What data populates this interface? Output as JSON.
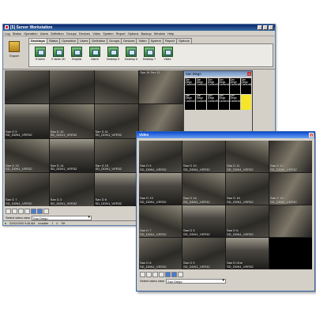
{
  "main_window": {
    "title": "[5] Server Workstation",
    "menu": [
      "Log",
      "Status",
      "Operation",
      "Users",
      "Definition",
      "Groups",
      "Devices",
      "Video",
      "System",
      "Report",
      "Options",
      "Backup",
      "Window",
      "Help"
    ],
    "export_label": "Export",
    "tabs": [
      "Desktops",
      "Status",
      "Operation",
      "Users",
      "Definition",
      "Groups",
      "Devices",
      "Video",
      "System",
      "Report",
      "Options"
    ],
    "toolbar_buttons": [
      "E.tsmlc",
      "E.tsmlc 3D",
      "Graphic",
      "Alarm",
      "Desktop 5",
      "Desktop 6",
      "Desktop 7",
      "Video"
    ],
    "cameras": [
      {
        "name": "",
        "detail": ""
      },
      {
        "name": "",
        "detail": ""
      },
      {
        "name": "",
        "detail": ""
      },
      {
        "name": "",
        "detail": "Sys 16 Sec 11"
      },
      {
        "name": "San D 9",
        "detail": "SD_DDN1_VER32"
      },
      {
        "name": "San D 10",
        "detail": "SD_DDN1_VER32"
      },
      {
        "name": "San D 11",
        "detail": "SD_DDN1_VER32"
      },
      {
        "name": "San D 12",
        "detail": "SD_DDN1_VER32"
      },
      {
        "name": "San D 13",
        "detail": "SD_DDN1_VER32"
      },
      {
        "name": "San D 14",
        "detail": "SD_DDN1_VER32"
      },
      {
        "name": "San D 15",
        "detail": "SD_DDN1_VER32"
      },
      {
        "name": "San D 16",
        "detail": "SD_DDN1_VER32"
      },
      {
        "name": "San D 7",
        "detail": "SD_DDN1_VER32"
      },
      {
        "name": "San D 3",
        "detail": "SD_DDN1_VER32"
      },
      {
        "name": "San D 6",
        "detail": "SD_DDN1_VER32"
      },
      {
        "name": "",
        "detail": ""
      }
    ],
    "bottom_row_extra": [
      "San D 8",
      "San D 9",
      "San D 10",
      "San D One"
    ],
    "select_label": "Select video view",
    "select_value": "San Diego",
    "status": {
      "date": "02/02/2005 9:48 AM",
      "state": "Invisible",
      "count_a": "1",
      "count_b": "0",
      "code": "SH"
    }
  },
  "camera_panel": {
    "title": "San Diego",
    "cells": [
      "San Diego Camera1",
      "San Diego Camera2",
      "San Diego Camera3",
      "San Diego Camera4",
      "San Diego Camera5",
      "San Diego Camera6",
      "San Diego Camera7",
      "San Diego Camera8",
      "San Diego Camera9",
      "San Diego Camera10",
      "San Diego Camera11",
      ""
    ]
  },
  "video_window": {
    "title": "Video",
    "cameras": [
      {
        "name": "San D 5",
        "detail": "SD_DDN1_VER32"
      },
      {
        "name": "San D 10",
        "detail": "SD_DDN1_VER32"
      },
      {
        "name": "San D 11",
        "detail": "SD_DDN1_VER32"
      },
      {
        "name": "San D 12",
        "detail": "SD_DDN1_VER32"
      },
      {
        "name": "San D 13",
        "detail": "SD_DDN1_VER32"
      },
      {
        "name": "San D 14",
        "detail": "SD_DDN1_VER32"
      },
      {
        "name": "San D 15",
        "detail": "SD_DDN1_VER32"
      },
      {
        "name": "San D 16",
        "detail": "SD_DDN1_VER32"
      },
      {
        "name": "San D 7",
        "detail": "SD_DDN1_VER32"
      },
      {
        "name": "San D 3",
        "detail": "SD_DDN1_VER32"
      },
      {
        "name": "San D 6",
        "detail": "SD_DDN1_VER32"
      },
      {
        "name": "",
        "detail": ""
      },
      {
        "name": "San D 8",
        "detail": "SD_DDN1_VER32"
      },
      {
        "name": "San D 9",
        "detail": "SD_DDN1_VER32"
      },
      {
        "name": "San D One",
        "detail": "SD_DDN1_VER32"
      },
      {
        "name": "",
        "detail": ""
      }
    ],
    "select_label": "Select video view",
    "select_value": "San Diego"
  }
}
